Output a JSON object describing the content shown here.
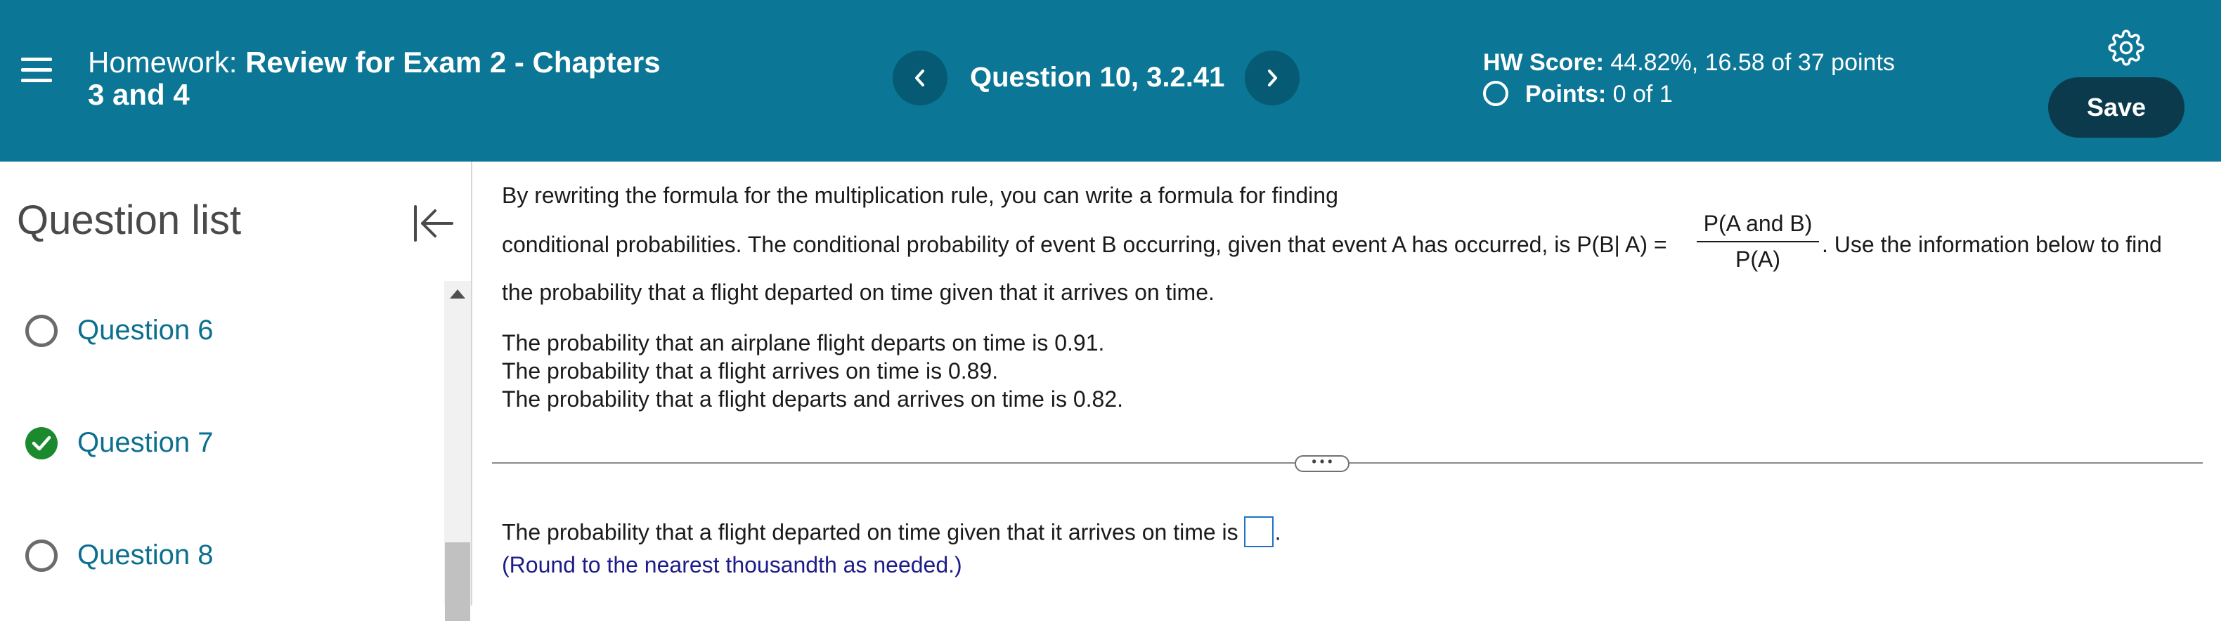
{
  "colors": {
    "header_bg": "#0b7696",
    "nav_button_bg": "#065a73",
    "save_button_bg": "#0c3a4d",
    "link_teal": "#0b6f8f",
    "correct_green": "#1b8a2e",
    "hint_navy": "#1c1c8a",
    "answer_box_border": "#1e73c8"
  },
  "header": {
    "menu_icon": "hamburger-menu-icon",
    "title_prefix": "Homework:",
    "title_line1": "Review for Exam 2 - Chapters",
    "title_line2": "3 and 4",
    "prev_icon": "chevron-left-icon",
    "question_label": "Question 10, 3.2.41",
    "next_icon": "chevron-right-icon",
    "score_label": "HW Score:",
    "score_value": "44.82%, 16.58 of 37 points",
    "points_label": "Points:",
    "points_value": "0 of 1",
    "settings_icon": "gear-icon",
    "save_label": "Save"
  },
  "sidebar": {
    "title": "Question list",
    "collapse_icon": "collapse-left-icon",
    "items": [
      {
        "label": "Question 6",
        "status": "unanswered"
      },
      {
        "label": "Question 7",
        "status": "correct"
      },
      {
        "label": "Question 8",
        "status": "unanswered"
      }
    ]
  },
  "question": {
    "line1": "By rewriting the formula for the multiplication rule, you can write a formula for finding",
    "line2_before": "conditional probabilities. The conditional probability of event B occurring, given that event A has occurred, is P(B| A) =",
    "frac_num": "P(A and B)",
    "frac_den": "P(A)",
    "line2_after": ". Use the information below to find",
    "line3": "the probability that a flight departed on time given that it arrives on time.",
    "facts": [
      "The probability that an airplane flight departs on time is 0.91.",
      "The probability that a flight arrives on time is 0.89.",
      "The probability that a flight departs and arrives on time is 0.82."
    ],
    "more_label": "• • •",
    "answer_prompt": "The probability that a flight departed on time given that it arrives on time is",
    "answer_end": ".",
    "hint": "(Round to the nearest thousandth as needed.)"
  }
}
